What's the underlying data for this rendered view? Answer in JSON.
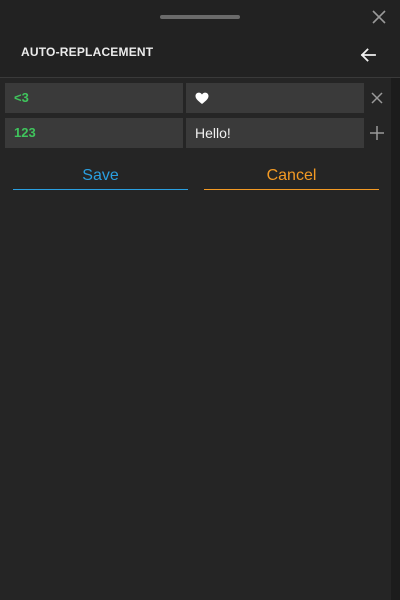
{
  "header": {
    "title": "AUTO-REPLACEMENT",
    "close_icon": "close-icon",
    "back_icon": "arrow-left-icon"
  },
  "rules": [
    {
      "key": "<3",
      "value": "♥",
      "action_icon": "close-icon"
    },
    {
      "key": "123",
      "value": "Hello!",
      "action_icon": "plus-icon"
    }
  ],
  "actions": {
    "save_label": "Save",
    "cancel_label": "Cancel"
  },
  "colors": {
    "background": "#252525",
    "key_text": "#3fc45c",
    "save": "#2a9fe0",
    "cancel": "#f39a24"
  }
}
